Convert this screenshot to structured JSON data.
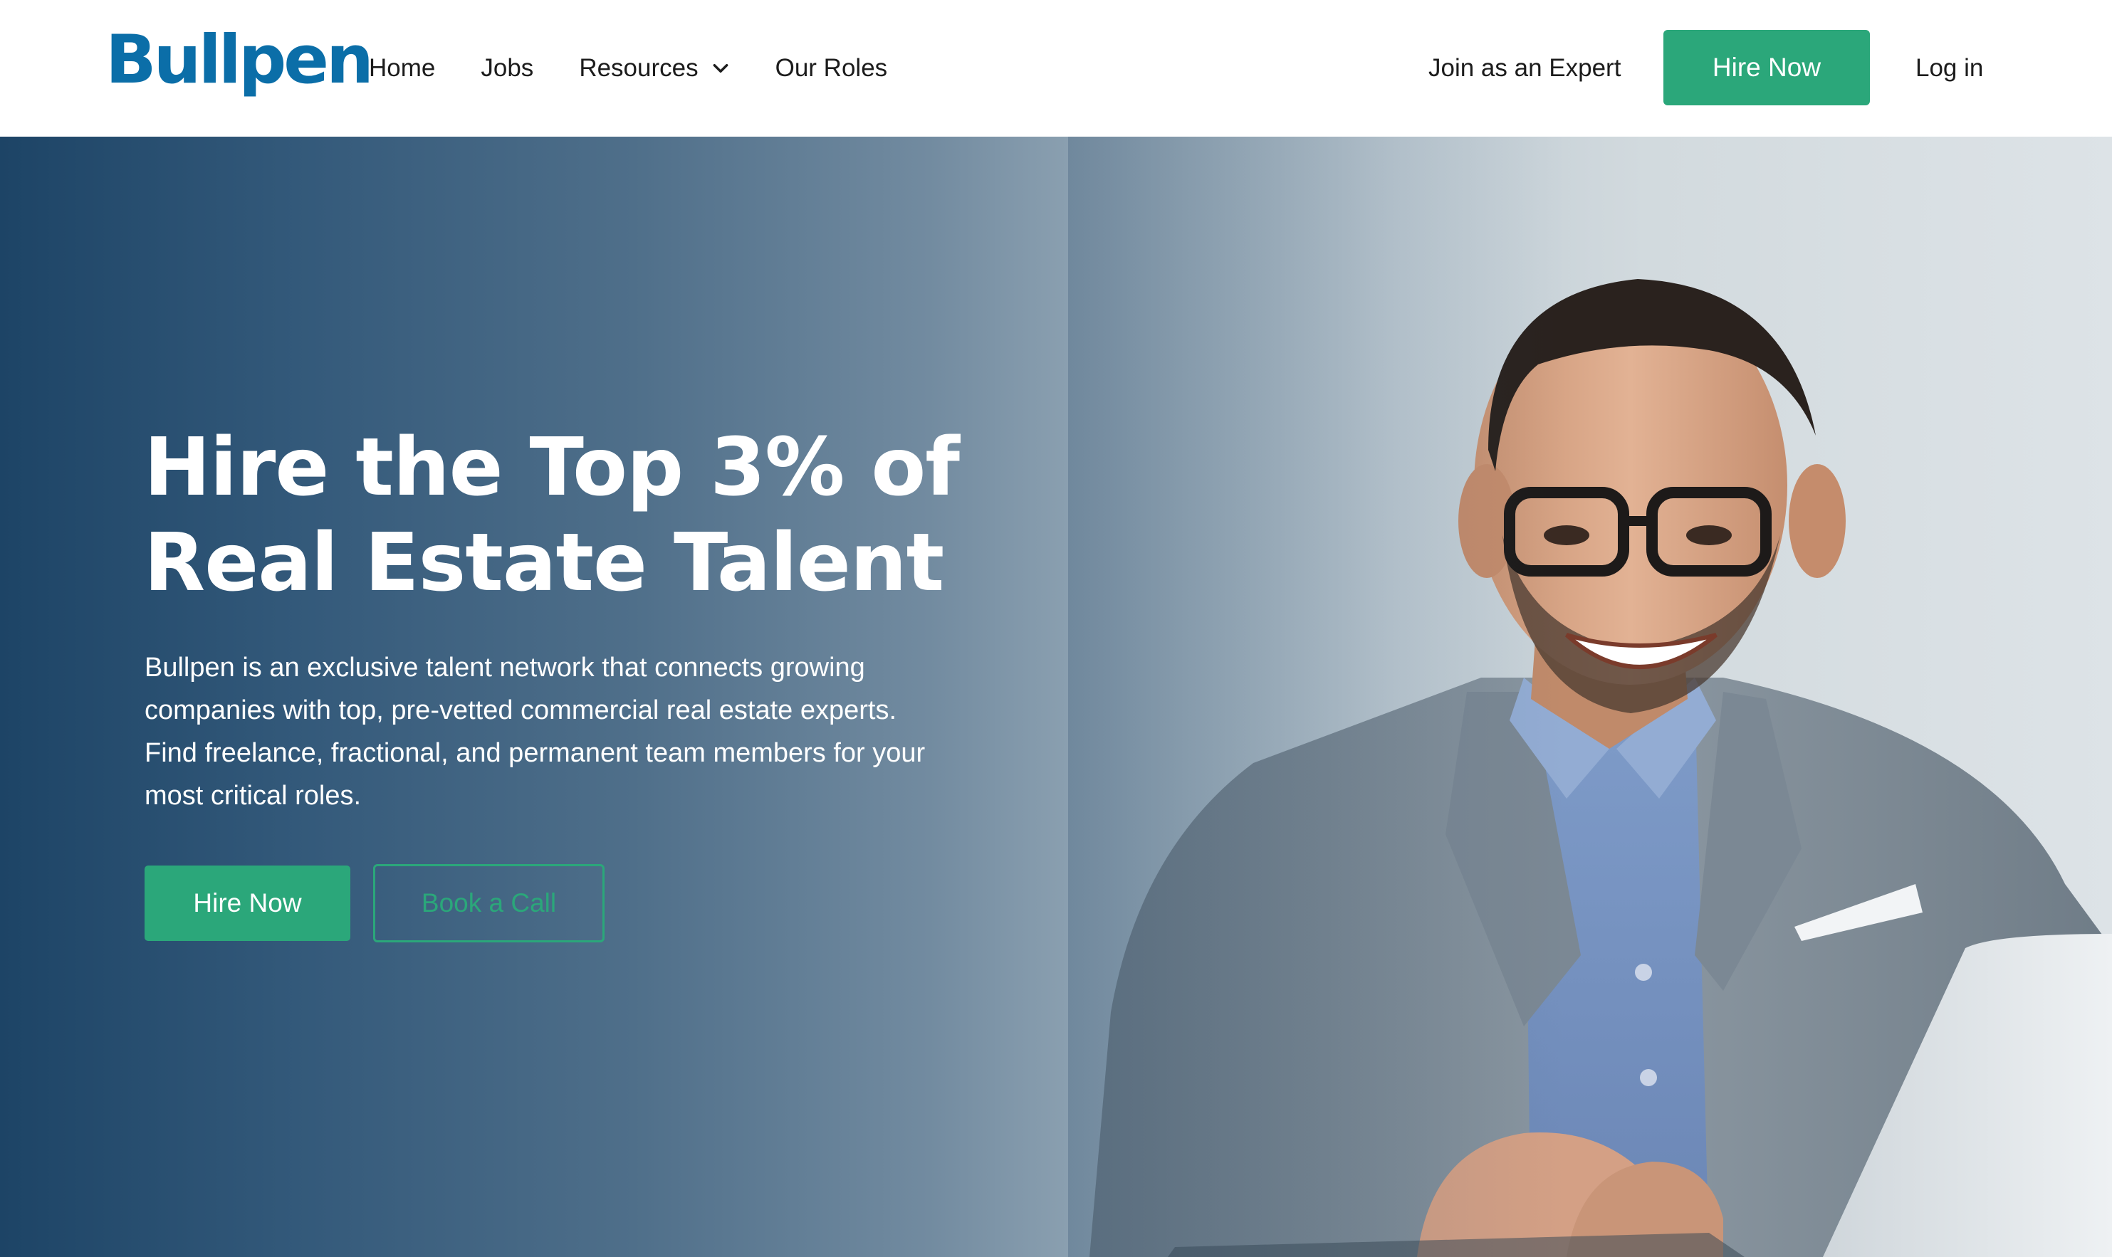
{
  "brand": {
    "logo_text": "Bullpen",
    "logo_color": "#0b6ea8"
  },
  "nav": {
    "home": "Home",
    "jobs": "Jobs",
    "resources": "Resources",
    "our_roles": "Our Roles",
    "join_expert": "Join as an Expert",
    "hire_now": "Hire Now",
    "log_in": "Log in"
  },
  "hero": {
    "title_line1": "Hire the Top 3% of",
    "title_line2": "Real Estate Talent",
    "description": "Bullpen is an exclusive talent network that connects growing companies with top, pre-vetted commercial real estate experts. Find freelance, fractional, and permanent team members for your most critical roles.",
    "primary_cta": "Hire Now",
    "secondary_cta": "Book a Call"
  },
  "colors": {
    "accent": "#2ba77a",
    "hero_gradient_start": "#1d4466",
    "hero_gradient_end": "#dde3e7"
  },
  "icons": {
    "resources_dropdown": "chevron-down-icon"
  }
}
